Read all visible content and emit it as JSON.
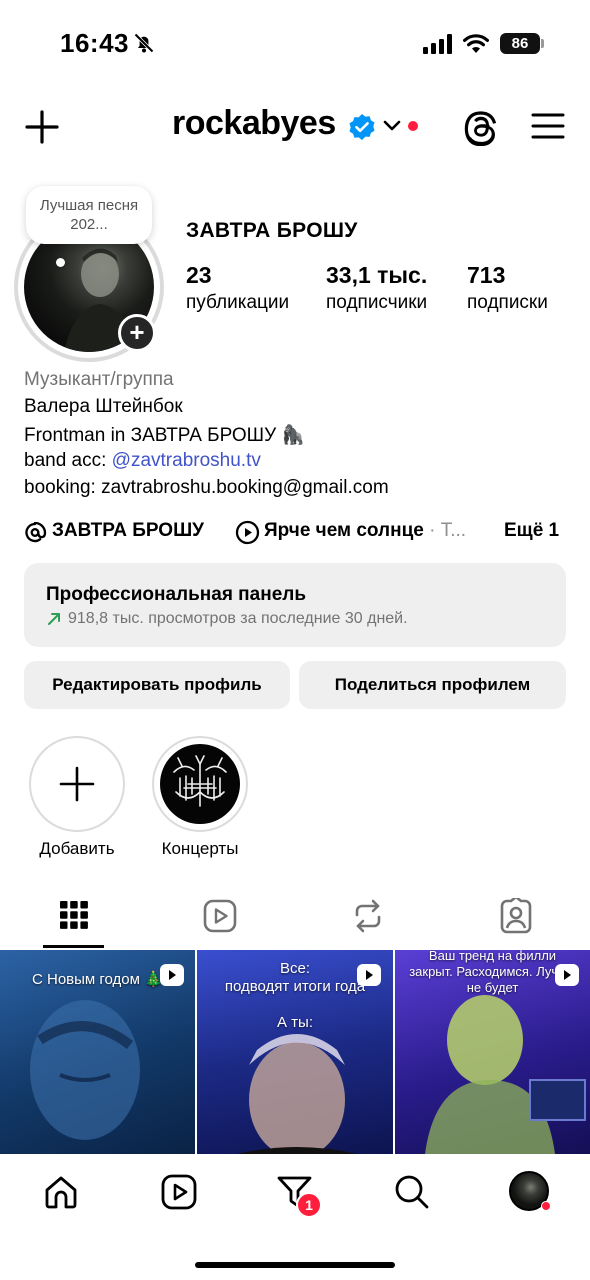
{
  "status_bar": {
    "time": "16:43",
    "battery": "86"
  },
  "header": {
    "username": "rockabyes",
    "icons": [
      "plus-icon",
      "verified-badge-icon",
      "chevron-down-icon",
      "threads-icon",
      "menu-icon"
    ]
  },
  "profile": {
    "note": "Лучшая песня 202...",
    "display_name": "ЗАВТРА БРОШУ",
    "stats": [
      {
        "value": "23",
        "label": "публикации"
      },
      {
        "value": "33,1 тыс.",
        "label": "подписчики"
      },
      {
        "value": "713",
        "label": "подписки"
      }
    ]
  },
  "bio": {
    "category": "Музыкант/группа",
    "name_line": "Валера Штейнбок",
    "frontman_line": "Frontman in ЗАВТРА БРОШУ 🦍",
    "band_prefix": "band acc: ",
    "band_link": "@zavtrabroshu.tv",
    "booking": "booking: zavtrabroshu.booking@gmail.com"
  },
  "pinned_row": {
    "threads_label": "ЗАВТРА БРОШУ",
    "music_title": "Ярче чем солнце",
    "music_sep": "· Т...",
    "more": "Ещё 1"
  },
  "pro_panel": {
    "title": "Профессиональная панель",
    "subtitle": "918,8 тыс. просмотров за последние 30 дней."
  },
  "buttons": {
    "edit": "Редактировать профиль",
    "share": "Поделиться профилем"
  },
  "highlights": [
    {
      "label": "Добавить"
    },
    {
      "label": "Концерты"
    }
  ],
  "tabs": [
    "grid-icon",
    "reels-icon",
    "reposts-icon",
    "tagged-icon"
  ],
  "grid": [
    {
      "caption": "С Новым годом 🎄",
      "colors": [
        "#1f4f8c",
        "#0d2a52"
      ]
    },
    {
      "caption": "Все:\nподводят итоги года",
      "caption2": "А ты:",
      "colors": [
        "#2b3fb0",
        "#0f1a5c"
      ]
    },
    {
      "caption": "Ваш тренд на филли\nзакрыт. Расходимся. Лучше\nне будет",
      "colors": [
        "#4c33b8",
        "#15105a"
      ]
    }
  ],
  "bottom_nav": {
    "badge": "1",
    "items": [
      "home-icon",
      "reels-icon",
      "activity-icon",
      "search-icon",
      "profile-avatar"
    ]
  },
  "colors": {
    "accent_link": "#4153c8",
    "verified": "#0095f6",
    "notification": "#ff1f3d",
    "panel_bg": "#efefef"
  }
}
